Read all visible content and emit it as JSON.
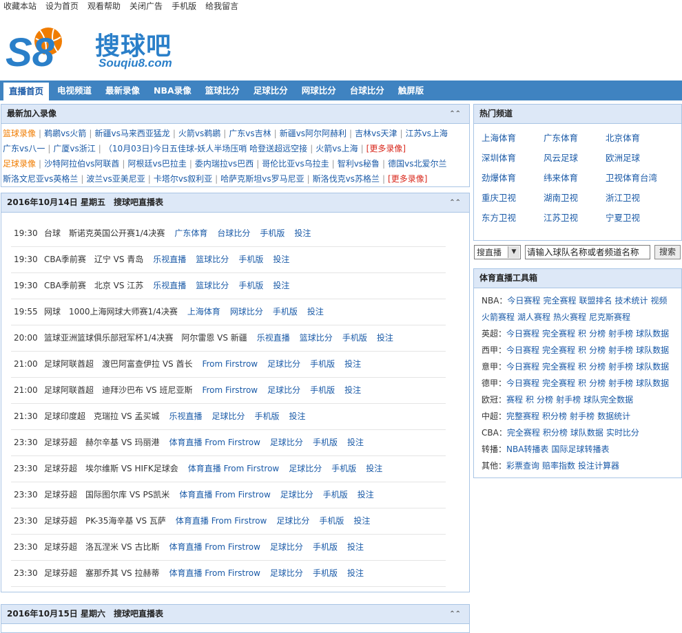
{
  "topbar": [
    "收藏本站",
    "设为首页",
    "观看帮助",
    "关闭广告",
    "手机版",
    "给我留言"
  ],
  "logo": {
    "mark": "S8",
    "cn": "搜球吧",
    "en": "Souqiu8.com",
    "color": "#2a7fc9",
    "accent": "#f07c00"
  },
  "nav": [
    "直播首页",
    "电视频道",
    "最新录像",
    "NBA录像",
    "篮球比分",
    "足球比分",
    "网球比分",
    "台球比分",
    "触屏版"
  ],
  "recent": {
    "title": "最新加入录像",
    "lines": [
      {
        "cat": "篮球录像",
        "items": [
          "鹈鹕vs火箭",
          "新疆vs马来西亚猛龙",
          "火箭vs鹈鹕",
          "广东vs吉林",
          "新疆vs阿尔阿赫利",
          "吉林vs天津",
          "江苏vs上海"
        ],
        "more": ""
      },
      {
        "cat": "",
        "items": [
          "广东vs八一",
          "广厦vs浙江",
          "（10月03日)今日五佳球-妖人半场压哨 哈登送超远空接",
          "火箭vs上海"
        ],
        "more": "[更多录像]"
      },
      {
        "cat": "足球录像",
        "items": [
          "沙特阿拉伯vs阿联酋",
          "阿根廷vs巴拉圭",
          "委内瑞拉vs巴西",
          "哥伦比亚vs乌拉圭",
          "智利vs秘鲁",
          "德国vs北爱尔兰"
        ],
        "more": ""
      },
      {
        "cat": "",
        "items": [
          "斯洛文尼亚vs英格兰",
          "波兰vs亚美尼亚",
          "卡塔尔vs叙利亚",
          "哈萨克斯坦vs罗马尼亚",
          "斯洛伐克vs苏格兰"
        ],
        "more": "[更多录像]"
      }
    ]
  },
  "schedule": {
    "title": "2016年10月14日 星期五　搜球吧直播表",
    "rows": [
      {
        "time": "19:30",
        "match": "台球　斯诺克英国公开赛1/4决赛",
        "links": [
          "广东体育",
          "台球比分",
          "手机版",
          "投注"
        ]
      },
      {
        "time": "19:30",
        "match": "CBA季前赛　辽宁 VS 青岛",
        "links": [
          "乐视直播",
          "篮球比分",
          "手机版",
          "投注"
        ]
      },
      {
        "time": "19:30",
        "match": "CBA季前赛　北京 VS 江苏",
        "links": [
          "乐视直播",
          "篮球比分",
          "手机版",
          "投注"
        ]
      },
      {
        "time": "19:55",
        "match": "网球　1000上海网球大师赛1/4决赛",
        "links": [
          "上海体育",
          "网球比分",
          "手机版",
          "投注"
        ]
      },
      {
        "time": "20:00",
        "match": "篮球亚洲篮球俱乐部冠军杯1/4决赛　阿尔雷恩 VS 新疆",
        "links": [
          "乐视直播",
          "篮球比分",
          "手机版",
          "投注"
        ]
      },
      {
        "time": "21:00",
        "match": "足球阿联酋超　渡巴阿富查伊拉 VS 酋长",
        "links": [
          "From Firstrow",
          "足球比分",
          "手机版",
          "投注"
        ]
      },
      {
        "time": "21:00",
        "match": "足球阿联酋超　迪拜沙巴布 VS 班尼亚斯",
        "links": [
          "From Firstrow",
          "足球比分",
          "手机版",
          "投注"
        ]
      },
      {
        "time": "21:30",
        "match": "足球印度超　克瑞拉 VS 孟买城",
        "links": [
          "乐视直播",
          "足球比分",
          "手机版",
          "投注"
        ]
      },
      {
        "time": "23:30",
        "match": "足球芬超　赫尔辛基 VS 玛丽港",
        "links": [
          "体育直播 From Firstrow",
          "足球比分",
          "手机版",
          "投注"
        ]
      },
      {
        "time": "23:30",
        "match": "足球芬超　埃尔维斯 VS HIFK足球会",
        "links": [
          "体育直播 From Firstrow",
          "足球比分",
          "手机版",
          "投注"
        ]
      },
      {
        "time": "23:30",
        "match": "足球芬超　国际图尔库 VS PS凯米",
        "links": [
          "体育直播 From Firstrow",
          "足球比分",
          "手机版",
          "投注"
        ]
      },
      {
        "time": "23:30",
        "match": "足球芬超　PK-35海辛基 VS 瓦萨",
        "links": [
          "体育直播 From Firstrow",
          "足球比分",
          "手机版",
          "投注"
        ]
      },
      {
        "time": "23:30",
        "match": "足球芬超　洛瓦涅米 VS 古比斯",
        "links": [
          "体育直播 From Firstrow",
          "足球比分",
          "手机版",
          "投注"
        ]
      },
      {
        "time": "23:30",
        "match": "足球芬超　塞那乔其 VS 拉赫蒂",
        "links": [
          "体育直播 From Firstrow",
          "足球比分",
          "手机版",
          "投注"
        ]
      }
    ]
  },
  "schedule2": {
    "title": "2016年10月15日 星期六　搜球吧直播表"
  },
  "hot": {
    "title": "热门频道",
    "channels": [
      "上海体育",
      "广东体育",
      "北京体育",
      "深圳体育",
      "风云足球",
      "欧洲足球",
      "劲爆体育",
      "纬来体育",
      "卫视体育台湾",
      "重庆卫视",
      "湖南卫视",
      "浙江卫视",
      "东方卫视",
      "江苏卫视",
      "宁夏卫视"
    ]
  },
  "search": {
    "select_value": "搜直播",
    "input_value": "请输入球队名称或者频道名称",
    "button": "搜索"
  },
  "tools": {
    "title": "体育直播工具箱",
    "lines": [
      {
        "label": "NBA：",
        "links": [
          "今日赛程",
          "完全赛程",
          "联盟排名",
          "技术统计",
          "视频"
        ]
      },
      {
        "label": "",
        "links": [
          "火箭赛程",
          "湖人赛程",
          "热火赛程",
          "尼克斯赛程"
        ]
      },
      {
        "label": "英超：",
        "links": [
          "今日赛程",
          "完全赛程",
          "积",
          "分榜",
          "射手榜",
          "球队数据"
        ]
      },
      {
        "label": "西甲：",
        "links": [
          "今日赛程",
          "完全赛程",
          "积",
          "分榜",
          "射手榜",
          "球队数据"
        ]
      },
      {
        "label": "意甲：",
        "links": [
          "今日赛程",
          "完全赛程",
          "积",
          "分榜",
          "射手榜",
          "球队数据"
        ]
      },
      {
        "label": "德甲：",
        "links": [
          "今日赛程",
          "完全赛程",
          "积",
          "分榜",
          "射手榜",
          "球队数据"
        ]
      },
      {
        "label": "欧冠：",
        "links": [
          "赛程",
          "积",
          "分榜",
          "射手榜",
          "球队完全数据"
        ]
      },
      {
        "label": "中超：",
        "links": [
          "完整赛程",
          "积分榜",
          "射手榜",
          "数据统计"
        ]
      },
      {
        "label": "CBA：",
        "links": [
          "完全赛程",
          "积分榜",
          "球队数据",
          "实时比分"
        ]
      },
      {
        "label": "转播：",
        "links": [
          "NBA转播表",
          "国际足球转播表"
        ]
      },
      {
        "label": "其他：",
        "links": [
          "彩票查询",
          "赔率指数",
          "投注计算器"
        ]
      }
    ]
  },
  "collapse_icon": "chevron-up-icon"
}
